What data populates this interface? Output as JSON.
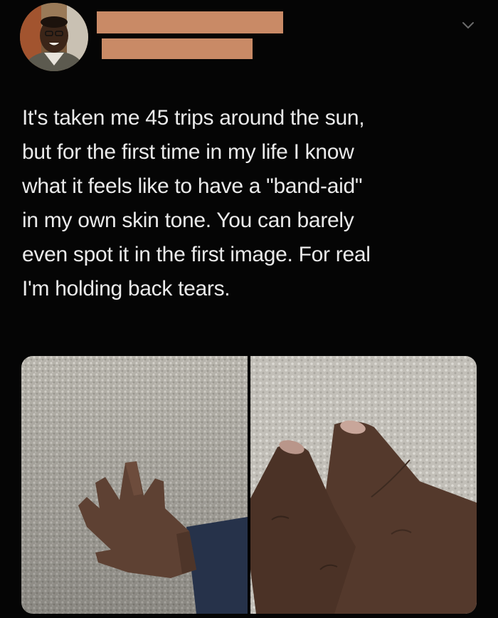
{
  "tweet": {
    "text_lines": [
      "It's taken me 45 trips around the sun,",
      "but for the first time in my life I know",
      "what it feels like to have a \"band-aid\"",
      "in my own skin tone. You can barely",
      "even spot it in the first image. For real",
      "I'm holding back tears."
    ]
  },
  "icons": {
    "menu": "chevron-down-icon"
  },
  "colors": {
    "background": "#000000",
    "text": "#eaeaea",
    "redaction": "#c98a66",
    "carpet": "#b9b6ae",
    "skin": "#5e4133",
    "sleeve": "#26324a"
  }
}
